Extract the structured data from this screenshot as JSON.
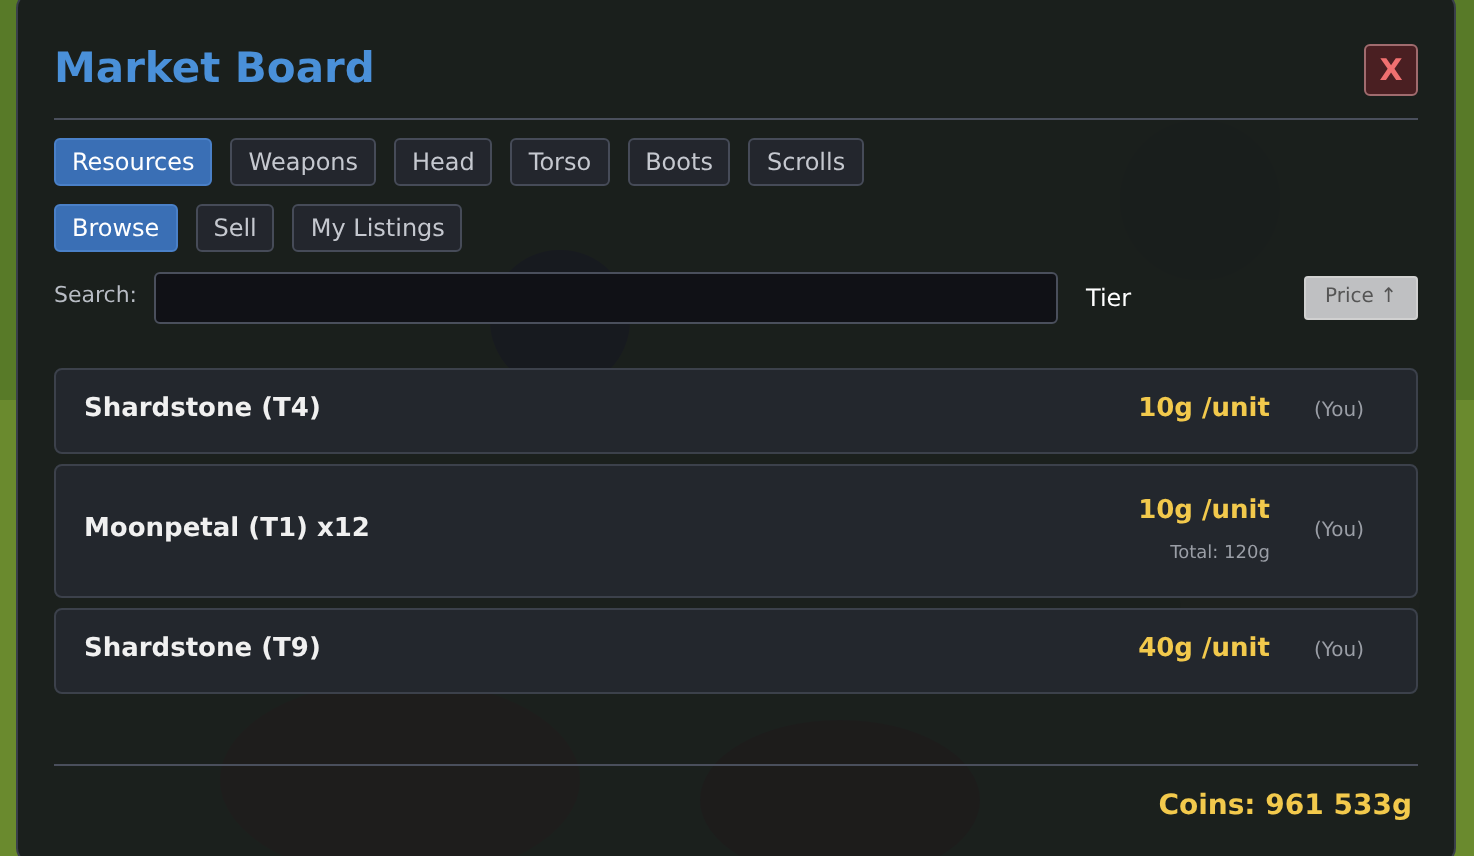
{
  "dialog": {
    "title": "Market Board",
    "close": "X"
  },
  "category_tabs": [
    {
      "label": "Resources",
      "selected": true
    },
    {
      "label": "Weapons",
      "selected": false
    },
    {
      "label": "Head",
      "selected": false
    },
    {
      "label": "Torso",
      "selected": false
    },
    {
      "label": "Boots",
      "selected": false
    },
    {
      "label": "Scrolls",
      "selected": false
    }
  ],
  "mode_tabs": [
    {
      "label": "Browse",
      "selected": true
    },
    {
      "label": "Sell",
      "selected": false
    },
    {
      "label": "My Listings",
      "selected": false
    }
  ],
  "search": {
    "label": "Search:",
    "tier_label": "Tier",
    "sort_button": "Price ↑"
  },
  "listings": [
    {
      "name": "Shardstone (T4)",
      "price": "10g /unit",
      "seller": "(You)"
    },
    {
      "name": "Moonpetal (T1) x12",
      "price": "10g /unit",
      "total": "Total: 120g",
      "seller": "(You)"
    },
    {
      "name": "Shardstone (T9)",
      "price": "40g /unit",
      "seller": "(You)"
    }
  ],
  "coins": "Coins: 961 533g"
}
